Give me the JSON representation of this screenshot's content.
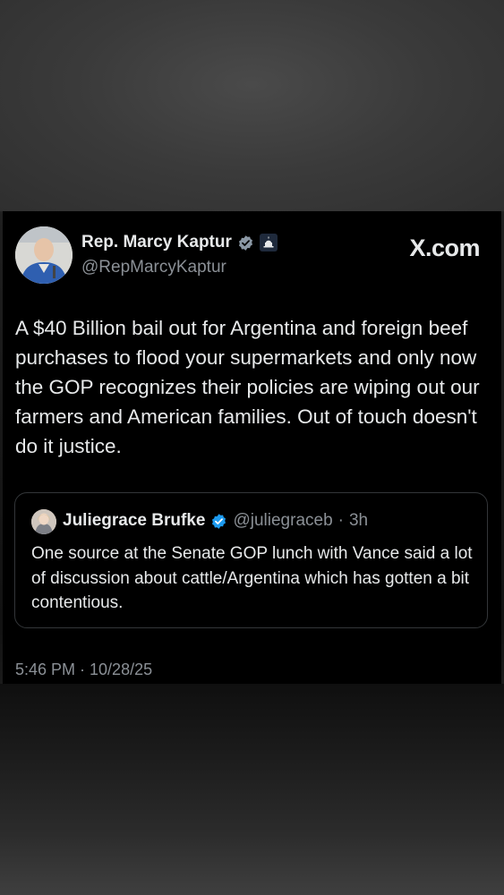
{
  "tweet": {
    "author_name": "Rep. Marcy Kaptur",
    "author_handle": "@RepMarcyKaptur",
    "site_label": "X.com",
    "text": "A $40 Billion bail out for Argentina and foreign beef purchases to flood your supermarkets and only now the GOP recognizes their policies are wiping out our farmers and American families. Out of touch doesn't do it justice.",
    "timestamp": "5:46 PM · 10/28/25",
    "verified_color": "#8b98a5",
    "gov_badge_icon": "capitol-icon"
  },
  "quote": {
    "author_name": "Juliegrace Brufke",
    "author_handle": "@juliegraceb",
    "separator": "·",
    "age": "3h",
    "text": "One source at the Senate GOP lunch with Vance said a lot of discussion about cattle/Argentina which has gotten a bit contentious.",
    "verified_color": "#1d9bf0"
  },
  "colors": {
    "card_background": "#000000",
    "primary_text": "#e7e9ea",
    "secondary_text": "#8b9096",
    "border": "#333639"
  }
}
